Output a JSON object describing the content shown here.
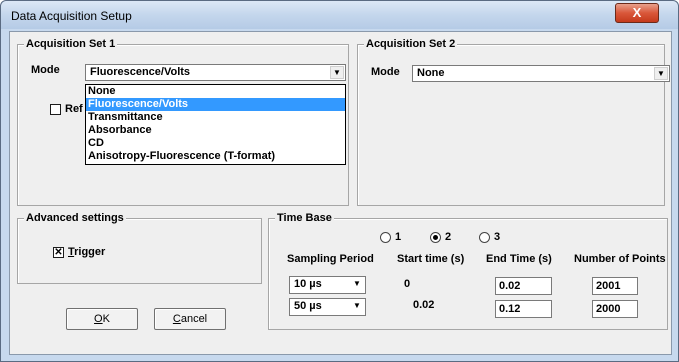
{
  "window": {
    "title": "Data Acquisition Setup",
    "close_glyph": "X"
  },
  "acq1": {
    "title": "Acquisition Set 1",
    "mode_label": "Mode",
    "mode_value": "Fluorescence/Volts",
    "ref_label_partial": "Ref",
    "options": [
      "None",
      "Fluorescence/Volts",
      "Transmittance",
      "Absorbance",
      "CD",
      "Anisotropy-Fluorescence (T-format)"
    ],
    "selected_option": "Fluorescence/Volts"
  },
  "acq2": {
    "title": "Acquisition Set 2",
    "mode_label": "Mode",
    "mode_value": "None"
  },
  "advanced": {
    "title": "Advanced settings",
    "trigger_accel": "T",
    "trigger_rest": "rigger",
    "trigger_checked": true
  },
  "timebase": {
    "title": "Time Base",
    "radios": [
      {
        "label": "1",
        "selected": false
      },
      {
        "label": "2",
        "selected": true
      },
      {
        "label": "3",
        "selected": false
      }
    ],
    "headers": {
      "sampling": "Sampling Period",
      "start": "Start time (s)",
      "end": "End Time (s)",
      "points": "Number of Points"
    },
    "rows": [
      {
        "sampling": "10 µs",
        "start": "0",
        "end": "0.02",
        "points": "2001"
      },
      {
        "sampling": "50 µs",
        "start": "0.02",
        "end": "0.12",
        "points": "2000"
      }
    ]
  },
  "buttons": {
    "ok_accel": "O",
    "ok_rest": "K",
    "cancel_accel": "C",
    "cancel_rest": "ancel"
  }
}
